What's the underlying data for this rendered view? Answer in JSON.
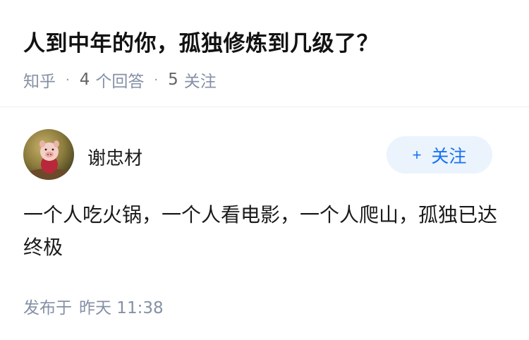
{
  "question": {
    "title": "人到中年的你，孤独修炼到几级了？",
    "source": "知乎",
    "answer_count": "4",
    "answer_label": "个回答",
    "follower_count": "5",
    "follower_label": "关注"
  },
  "answer": {
    "author": "谢忠材",
    "avatar_icon": "piglet-avatar-icon",
    "follow_plus": "+",
    "follow_label": "关注",
    "content": "一个人吃火锅，一个人看电影，一个人爬山，孤独已达终极",
    "published_label": "发布于",
    "published_time": "昨天 11:38"
  },
  "colors": {
    "accent": "#1772f6",
    "follow_bg": "#ebf3fc",
    "meta": "#8590a6"
  }
}
